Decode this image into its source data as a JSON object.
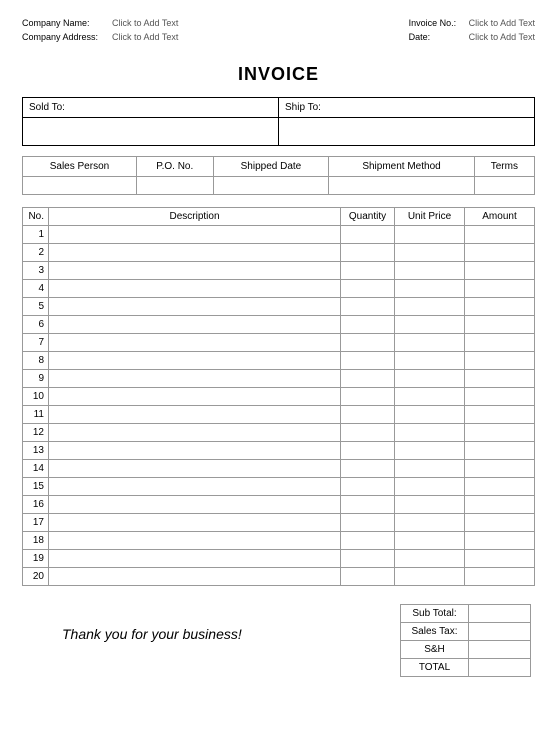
{
  "header": {
    "company_name_label": "Company Name:",
    "company_name_value": "Click to Add Text",
    "company_address_label": "Company Address:",
    "company_address_value": "Click to Add Text",
    "invoice_no_label": "Invoice No.:",
    "invoice_no_value": "Click to Add Text",
    "date_label": "Date:",
    "date_value": "Click to Add Text"
  },
  "title": "INVOICE",
  "address": {
    "sold_to_label": "Sold To:",
    "ship_to_label": "Ship To:"
  },
  "shipment": {
    "sales_person": "Sales Person",
    "po_no": "P.O. No.",
    "shipped_date": "Shipped Date",
    "shipment_method": "Shipment Method",
    "terms": "Terms"
  },
  "items_header": {
    "no": "No.",
    "description": "Description",
    "quantity": "Quantity",
    "unit_price": "Unit Price",
    "amount": "Amount"
  },
  "items": [
    {
      "no": "1"
    },
    {
      "no": "2"
    },
    {
      "no": "3"
    },
    {
      "no": "4"
    },
    {
      "no": "5"
    },
    {
      "no": "6"
    },
    {
      "no": "7"
    },
    {
      "no": "8"
    },
    {
      "no": "9"
    },
    {
      "no": "10"
    },
    {
      "no": "11"
    },
    {
      "no": "12"
    },
    {
      "no": "13"
    },
    {
      "no": "14"
    },
    {
      "no": "15"
    },
    {
      "no": "16"
    },
    {
      "no": "17"
    },
    {
      "no": "18"
    },
    {
      "no": "19"
    },
    {
      "no": "20"
    }
  ],
  "totals": {
    "sub_total": "Sub Total:",
    "sales_tax": "Sales Tax:",
    "sh": "S&H",
    "total": "TOTAL"
  },
  "thanks": "Thank you for your business!"
}
